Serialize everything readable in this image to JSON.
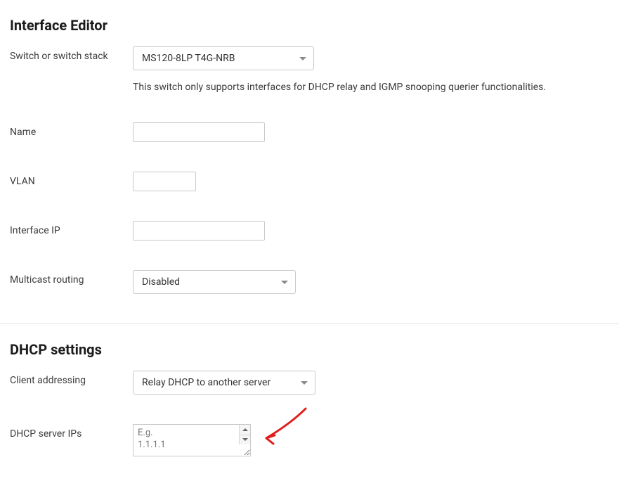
{
  "interface_editor": {
    "title": "Interface Editor",
    "switch_label": "Switch or switch stack",
    "switch_value": "MS120-8LP T4G-NRB",
    "switch_helper": "This switch only supports interfaces for DHCP relay and IGMP snooping querier functionalities.",
    "name_label": "Name",
    "name_value": "",
    "vlan_label": "VLAN",
    "vlan_value": "",
    "ip_label": "Interface IP",
    "ip_value": "",
    "multicast_label": "Multicast routing",
    "multicast_value": "Disabled"
  },
  "dhcp": {
    "title": "DHCP settings",
    "client_addr_label": "Client addressing",
    "client_addr_value": "Relay DHCP to another server",
    "server_ips_label": "DHCP server IPs",
    "server_ips_placeholder": "E.g.\n1.1.1.1",
    "server_ips_value": ""
  }
}
